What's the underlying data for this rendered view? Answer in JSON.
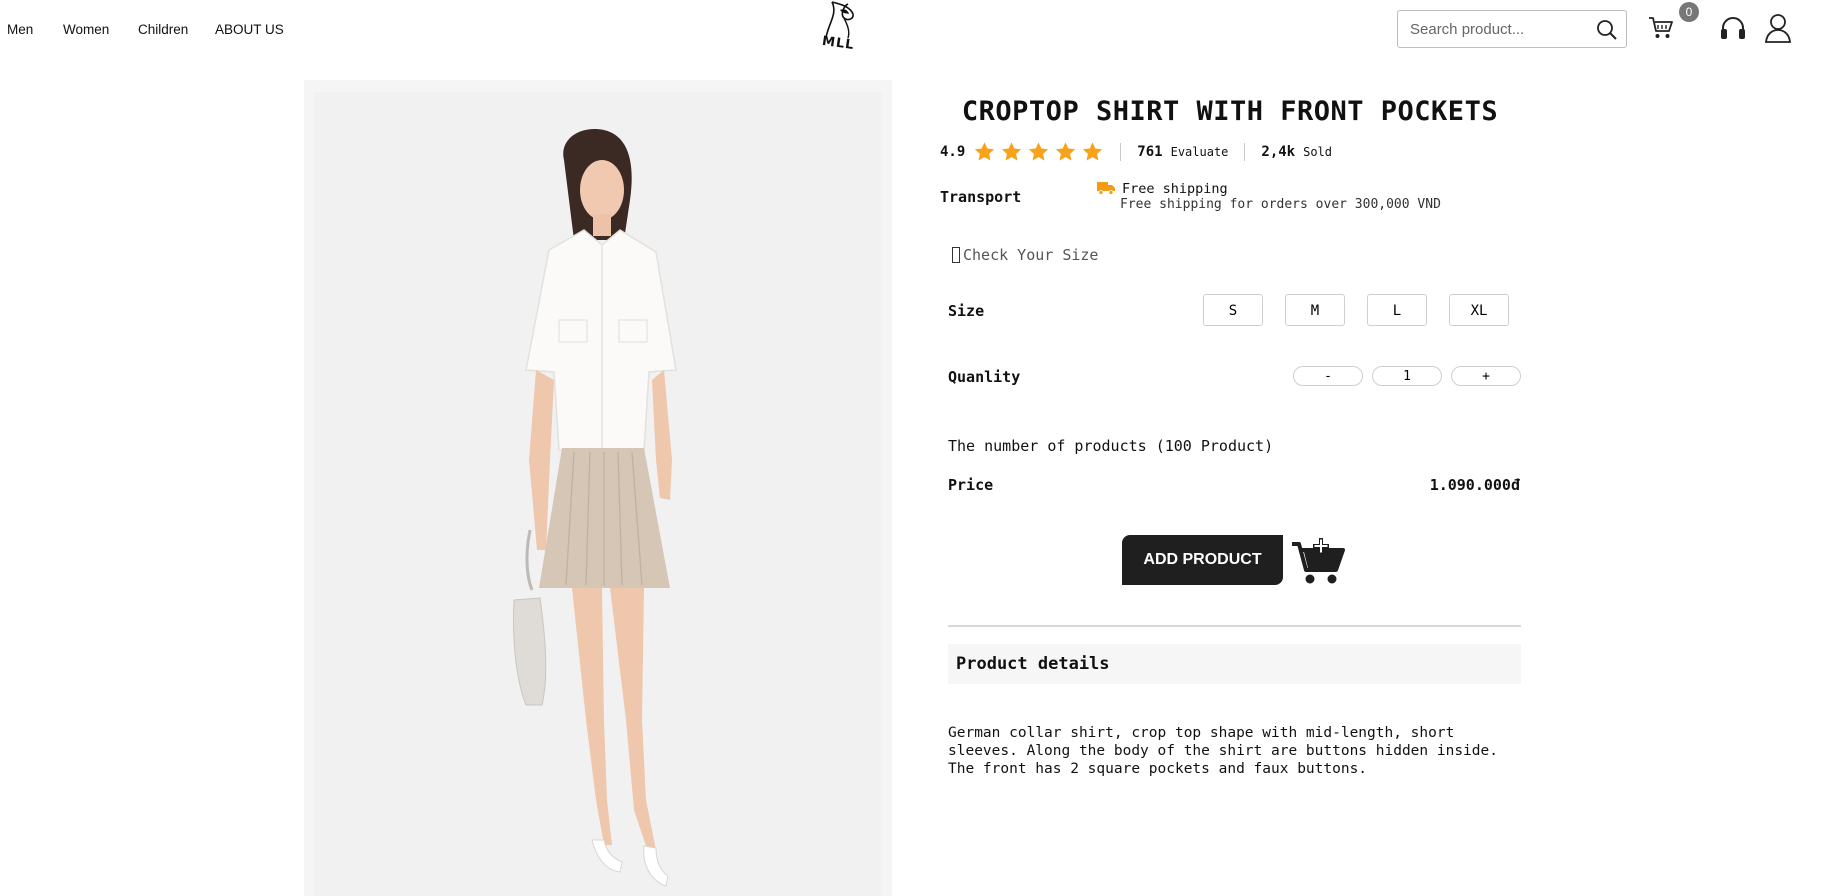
{
  "nav": {
    "links": [
      "Men",
      "Women",
      "Children",
      "ABOUT US"
    ],
    "logo_text": "MLL",
    "search_placeholder": "Search product...",
    "cart_count": "0"
  },
  "product": {
    "title": "CROPTOP SHIRT WITH FRONT POCKETS",
    "rating": "4.9",
    "stars": 5,
    "evaluate_count": "761",
    "evaluate_label": "Evaluate",
    "sold_count": "2,4k",
    "sold_label": "Sold",
    "transport_label": "Transport",
    "shipping_title": "Free shipping",
    "shipping_desc": "Free shipping for orders over 300,000 VND",
    "size_check": "Check Your Size",
    "size_label": "Size",
    "sizes": [
      "S",
      "M",
      "L",
      "XL"
    ],
    "quantity_label": "Quanlity",
    "qty_minus": "-",
    "qty_value": "1",
    "qty_plus": "+",
    "stock_text": "The number of products (100 Product)",
    "price_label": "Price",
    "price_value": "1.090.000đ",
    "add_button": "ADD PRODUCT",
    "details_title": "Product details",
    "details_text": "German collar shirt, crop top shape with mid-length, short sleeves. Along the body of the shirt are buttons hidden inside. The front has 2 square pockets and faux buttons."
  },
  "colors": {
    "star": "#f7a21b",
    "shipping_icon": "#f39c12",
    "button_dark": "#1f1f1f"
  }
}
